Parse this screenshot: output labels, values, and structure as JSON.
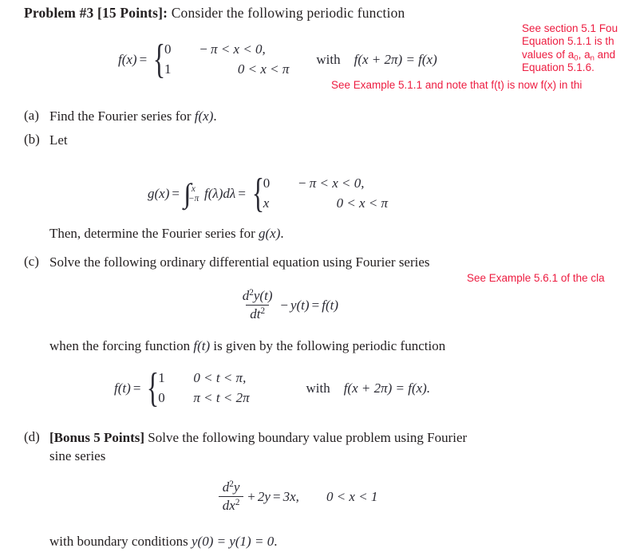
{
  "document": {
    "title_prefix": "Problem #3 [15 Points]:",
    "title_rest": " Consider the following periodic function"
  },
  "colors": {
    "annotation_red": "#ed1c40",
    "body_text": "#231f20",
    "math_text": "#2a2a33"
  },
  "annotations": [
    {
      "id": "annot-1-line-1",
      "text": "See section 5.1 Fou"
    },
    {
      "id": "annot-1-line-2",
      "text": "Equation 5.1.1 is th"
    },
    {
      "id": "annot-1-line-3a",
      "text": "values of a"
    },
    {
      "id": "annot-1-line-3b",
      "text": "0"
    },
    {
      "id": "annot-1-line-3c",
      "text": ", a"
    },
    {
      "id": "annot-1-line-3d",
      "text": "n"
    },
    {
      "id": "annot-1-line-3e",
      "text": " and"
    },
    {
      "id": "annot-1-line-4",
      "text": "Equation 5.1.6."
    },
    {
      "id": "annot-2",
      "text": "See Example 5.1.1 and note that f(t) is now f(x) in thi"
    },
    {
      "id": "annot-3",
      "text": "See Example 5.6.1 of the cla"
    }
  ],
  "eq_fx": {
    "lhs": "f(x)",
    "equals": "=",
    "row1_value": "0",
    "row1_cond_minus": "−",
    "row1_cond": "π < x < 0,",
    "row2_value": "1",
    "row2_cond": "0 < x < π",
    "with_word": "with",
    "periodicity": "f(x + 2π) = f(x)"
  },
  "part_a": {
    "label": "(a)",
    "text": "Find the Fourier series for ",
    "math": "f(x)",
    "period": "."
  },
  "part_b": {
    "label": "(b)",
    "text": "Let",
    "eq_g": {
      "lhs": "g(x)",
      "equals": "=",
      "int_upper": "x",
      "int_lower": "−π",
      "integrand": "f(λ)dλ",
      "equals2": "=",
      "row1_value": "0",
      "row1_cond_minus": "−",
      "row1_cond": "π < x < 0,",
      "row2_value": "x",
      "row2_cond": "0 < x < π"
    },
    "then_text": "Then, determine the Fourier series for ",
    "then_math": "g(x)",
    "then_period": "."
  },
  "part_c": {
    "label": "(c)",
    "text": "Solve the following ordinary differential equation using Fourier series",
    "ode": {
      "num_d": "d",
      "num_exp": "2",
      "num_y": "y(t)",
      "den_d": "dt",
      "den_exp": "2",
      "minus": "−",
      "y_t": "y(t)",
      "equals": "=",
      "f_t": "f(t)"
    },
    "forcing_pre": "when the forcing function ",
    "forcing_math": "f(t)",
    "forcing_post": " is given by the following periodic function",
    "eq_ft": {
      "lhs": "f(t)",
      "equals": "=",
      "row1_value": "1",
      "row1_cond": "0 < t < π,",
      "row2_value": "0",
      "row2_cond": "π < t < 2π",
      "with_word": "with",
      "periodicity": "f(x + 2π) = f(x)."
    }
  },
  "part_d": {
    "label": "(d)",
    "bonus": "[Bonus 5 Points]",
    "text": " Solve the following boundary value problem using Fourier",
    "text_line2": "sine series",
    "bvp": {
      "num_d": "d",
      "num_exp": "2",
      "num_y": "y",
      "den_d": "dx",
      "den_exp": "2",
      "plus": "+",
      "two_y": "2y",
      "equals": "=",
      "rhs": "3x,",
      "domain": "0 < x < 1"
    },
    "bc_pre": "with boundary conditions ",
    "bc_math": "y(0) = y(1) = 0",
    "bc_post": "."
  }
}
